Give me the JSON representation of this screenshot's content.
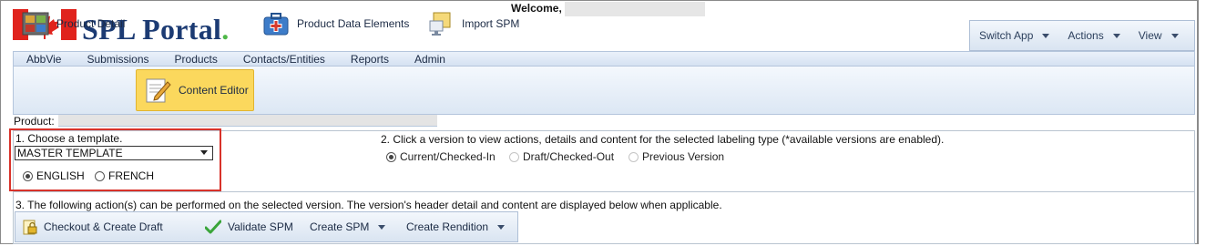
{
  "header": {
    "brand_name": "SPL Portal",
    "brand_dot": ".",
    "welcome_label": "Welcome,",
    "top_menu": [
      {
        "label": "Switch App"
      },
      {
        "label": "Actions"
      },
      {
        "label": "View"
      }
    ]
  },
  "nav": {
    "items": [
      {
        "label": "AbbVie"
      },
      {
        "label": "Submissions"
      },
      {
        "label": "Products"
      },
      {
        "label": "Contacts/Entities"
      },
      {
        "label": "Reports"
      },
      {
        "label": "Admin"
      }
    ]
  },
  "toolbar": {
    "items": [
      {
        "label": "Product Detail",
        "active": false
      },
      {
        "label": "Content Editor",
        "active": true
      },
      {
        "label": "Product Data Elements",
        "active": false
      },
      {
        "label": "Import SPM",
        "active": false
      }
    ]
  },
  "product": {
    "label": "Product:"
  },
  "section1": {
    "title": "1. Choose a template.",
    "template_selected": "MASTER TEMPLATE",
    "languages": [
      {
        "label": "ENGLISH",
        "selected": true
      },
      {
        "label": "FRENCH",
        "selected": false
      }
    ]
  },
  "section2": {
    "title": "2. Click a version to view actions, details and content for the selected labeling type (*available versions are enabled).",
    "versions": [
      {
        "label": "Current/Checked-In",
        "selected": true,
        "enabled": true
      },
      {
        "label": "Draft/Checked-Out",
        "selected": false,
        "enabled": false
      },
      {
        "label": "Previous Version",
        "selected": false,
        "enabled": false
      }
    ]
  },
  "section3": {
    "title": "3. The following action(s) can be performed on the selected version. The version's header detail and content are displayed below when applicable.",
    "actions": [
      {
        "label": "Checkout & Create Draft",
        "icon": "lock-document-icon"
      },
      {
        "label": "Validate SPM",
        "icon": "checkmark-icon"
      },
      {
        "label": "Create SPM",
        "icon": "none"
      },
      {
        "label": "Create Rendition",
        "icon": "none"
      }
    ]
  },
  "colors": {
    "brand_blue": "#1c3b73",
    "brand_green": "#4fb848",
    "flag_red": "#e0231d",
    "highlight_red": "#d8322a",
    "active_tab": "#fbd85d"
  }
}
